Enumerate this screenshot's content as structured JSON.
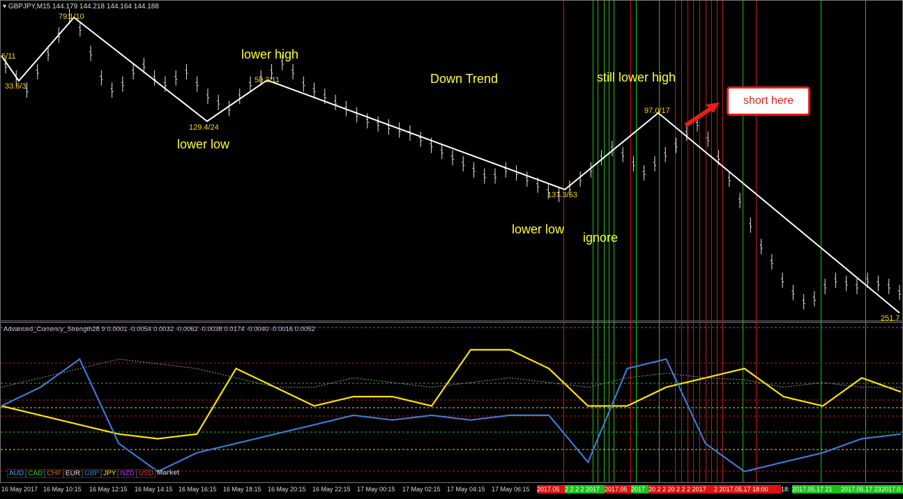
{
  "symbol": "GBPJPY,M15  144.179 144.218 144.164 144.188",
  "indicator": "Advanced_Currency_Strength28 9 0.0001 -0.0054 0.0032 -0.0062 -0.0038 0.0174 -0.0040 -0.0016 0.0052",
  "annotations": {
    "lower_high": "lower high",
    "down_trend": "Down Trend",
    "still_lower_high": "still lower high",
    "lower_low_1": "lower low",
    "lower_low_2": "lower low",
    "ignore": "ignore",
    "short_here": "short here"
  },
  "zigzag_labels": [
    "5/11",
    "33.6/3",
    "79.1/10",
    "129.4/24",
    "50.2/11",
    "137.3/53",
    "97.0/17",
    "251.7"
  ],
  "legend": [
    {
      "label": "AUD",
      "color": "#2aa8ff"
    },
    {
      "label": "CAD",
      "color": "#1fd21f"
    },
    {
      "label": "CHF",
      "color": "#d2691e"
    },
    {
      "label": "EUR",
      "color": "#e6e6e6"
    },
    {
      "label": "GBP",
      "color": "#3a7bd5"
    },
    {
      "label": "JPY",
      "color": "#ffe600"
    },
    {
      "label": "NZD",
      "color": "#c030ff"
    },
    {
      "label": "USD",
      "color": "#ff3030"
    }
  ],
  "market_label": "Market",
  "time_ticks": [
    "16 May 2017",
    "16 May 10:15",
    "16 May 12:15",
    "16 May 14:15",
    "16 May 16:15",
    "16 May 18:15",
    "16 May 20:15",
    "16 May 22:15",
    "17 May 00:15",
    "17 May 02:15",
    "17 May 04:15",
    "17 May 06:15"
  ],
  "time_boxes": [
    {
      "text": "2017.05",
      "color": "#e01010"
    },
    {
      "text": "2 2 2 2 2017",
      "color": "#17c417"
    },
    {
      "text": "2017.05",
      "color": "#e01010"
    },
    {
      "text": "2017",
      "color": "#17c417"
    },
    {
      "text": "20 2 2 20 2 2 2 2017",
      "color": "#e01010"
    },
    {
      "text": "2 2017.05.17 18:00",
      "color": "#e01010"
    },
    {
      "text": "18:",
      "color": "#000000"
    },
    {
      "text": "2017.05.17 21",
      "color": "#17c417"
    },
    {
      "text": "2017.05.17 23",
      "color": "#17c417"
    },
    {
      "text": "2017.0",
      "color": "#17c417"
    }
  ],
  "chart_data": {
    "type": "line",
    "title": "GBPJPY,M15",
    "price_series": {
      "name": "GBPJPY",
      "values": [
        144.62,
        144.58,
        144.54,
        144.6,
        144.66,
        144.72,
        144.78,
        144.74,
        144.66,
        144.58,
        144.54,
        144.56,
        144.6,
        144.62,
        144.58,
        144.56,
        144.58,
        144.6,
        144.56,
        144.52,
        144.5,
        144.48,
        144.52,
        144.56,
        144.58,
        144.6,
        144.63,
        144.6,
        144.56,
        144.54,
        144.52,
        144.5,
        144.48,
        144.46,
        144.44,
        144.43,
        144.42,
        144.41,
        144.4,
        144.38,
        144.36,
        144.34,
        144.32,
        144.3,
        144.28,
        144.26,
        144.26,
        144.28,
        144.27,
        144.25,
        144.23,
        144.21,
        144.2,
        144.22,
        144.25,
        144.28,
        144.32,
        144.35,
        144.33,
        144.3,
        144.27,
        144.3,
        144.33,
        144.36,
        144.4,
        144.43,
        144.38,
        144.32,
        144.25,
        144.18,
        144.1,
        144.03,
        143.98,
        143.92,
        143.88,
        143.85,
        143.86,
        143.9,
        143.92,
        143.91,
        143.9,
        143.92,
        143.91,
        143.9,
        143.88
      ]
    },
    "zigzag": [
      {
        "bar": 0,
        "label": "5/11"
      },
      {
        "bar": 3,
        "label": "33.6/3"
      },
      {
        "bar": 15,
        "label": "79.1/10"
      },
      {
        "bar": 43,
        "label": "129.4/24"
      },
      {
        "bar": 56,
        "label": "50.2/11"
      },
      {
        "bar": 118,
        "label": "137.3/53"
      },
      {
        "bar": 138,
        "label": "97.0/17"
      },
      {
        "bar": 186,
        "label": "251.7"
      }
    ],
    "strength_series": [
      {
        "name": "JPY",
        "color": "#ffe600",
        "values": [
          0.0,
          -0.01,
          -0.02,
          -0.03,
          -0.035,
          -0.03,
          0.04,
          0.02,
          0.0,
          0.01,
          0.01,
          0.0,
          0.06,
          0.06,
          0.04,
          0.0,
          0.0,
          0.02,
          0.03,
          0.04,
          0.01,
          0.0,
          0.03,
          0.015
        ]
      },
      {
        "name": "GBP",
        "color": "#3a7bd5",
        "values": [
          0.0,
          0.02,
          0.05,
          -0.04,
          -0.07,
          -0.05,
          -0.04,
          -0.03,
          -0.02,
          -0.01,
          -0.015,
          -0.01,
          -0.015,
          -0.01,
          -0.01,
          -0.06,
          0.04,
          0.05,
          -0.04,
          -0.07,
          -0.06,
          -0.05,
          -0.035,
          -0.03
        ]
      },
      {
        "name": "EUR",
        "color": "#9a9a9a",
        "values": [
          0.02,
          0.03,
          0.04,
          0.05,
          0.045,
          0.04,
          0.03,
          0.02,
          0.02,
          0.03,
          0.025,
          0.02,
          0.025,
          0.03,
          0.025,
          0.02,
          0.03,
          0.035,
          0.03,
          0.028,
          0.02,
          0.025,
          0.02,
          0.02
        ]
      }
    ],
    "level_lines": [
      0.07,
      0.05,
      0.03,
      0.02,
      0.01,
      -0.01,
      -0.03,
      -0.05
    ]
  }
}
